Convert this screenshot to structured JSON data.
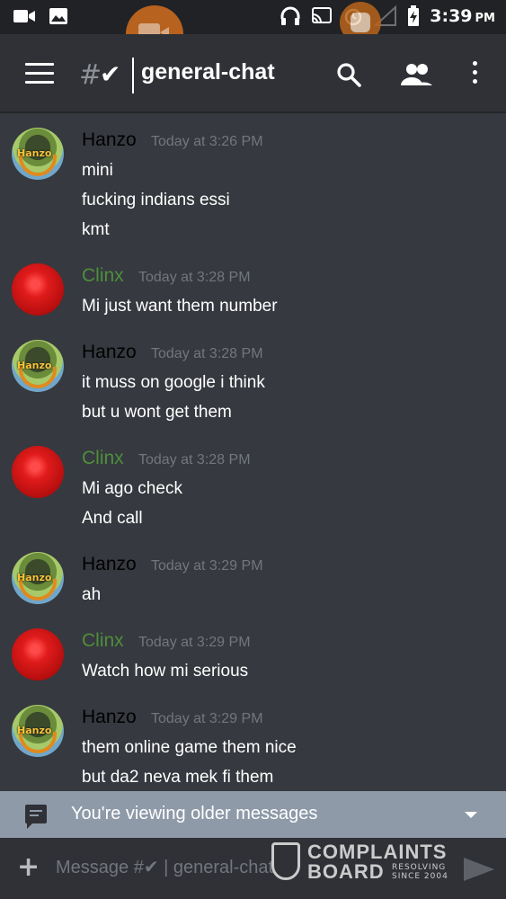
{
  "status_bar": {
    "time": "3:39",
    "ampm": "PM",
    "left_icons": [
      "video-camera-icon",
      "gallery-icon"
    ],
    "right_icons": [
      "headphones-icon",
      "cast-icon",
      "alarm-icon",
      "signal-icon",
      "battery-charging-icon"
    ]
  },
  "toolbar": {
    "hash": "#",
    "check": "✔",
    "channel": "general-chat"
  },
  "messages": [
    {
      "author": "Hanzo",
      "author_type": "hanzo",
      "timestamp": "Today at 3:26 PM",
      "lines": [
        "mini",
        "fucking indians essi",
        "kmt"
      ]
    },
    {
      "author": "Clinx",
      "author_type": "clinx",
      "timestamp": "Today at 3:28 PM",
      "lines": [
        "Mi just want them number"
      ]
    },
    {
      "author": "Hanzo",
      "author_type": "hanzo",
      "timestamp": "Today at 3:28 PM",
      "lines": [
        "it muss on google i think",
        "but u wont get them"
      ]
    },
    {
      "author": "Clinx",
      "author_type": "clinx",
      "timestamp": "Today at 3:28 PM",
      "lines": [
        "Mi ago check",
        "And call"
      ]
    },
    {
      "author": "Hanzo",
      "author_type": "hanzo",
      "timestamp": "Today at 3:29 PM",
      "lines": [
        "ah"
      ]
    },
    {
      "author": "Clinx",
      "author_type": "clinx",
      "timestamp": "Today at 3:29 PM",
      "lines": [
        "Watch how mi serious"
      ]
    },
    {
      "author": "Hanzo",
      "author_type": "hanzo",
      "timestamp": "Today at 3:29 PM",
      "lines": [
        "them online game them nice",
        "but da2 neva mek fi them"
      ]
    }
  ],
  "older_bar": {
    "text": "You're viewing older messages"
  },
  "composer": {
    "placeholder": "Message #✔ | general-chat"
  },
  "watermark": {
    "line1": "COMPLAINTS",
    "line2": "BOARD",
    "sub1": "RESOLVING",
    "sub2": "SINCE 2004"
  }
}
